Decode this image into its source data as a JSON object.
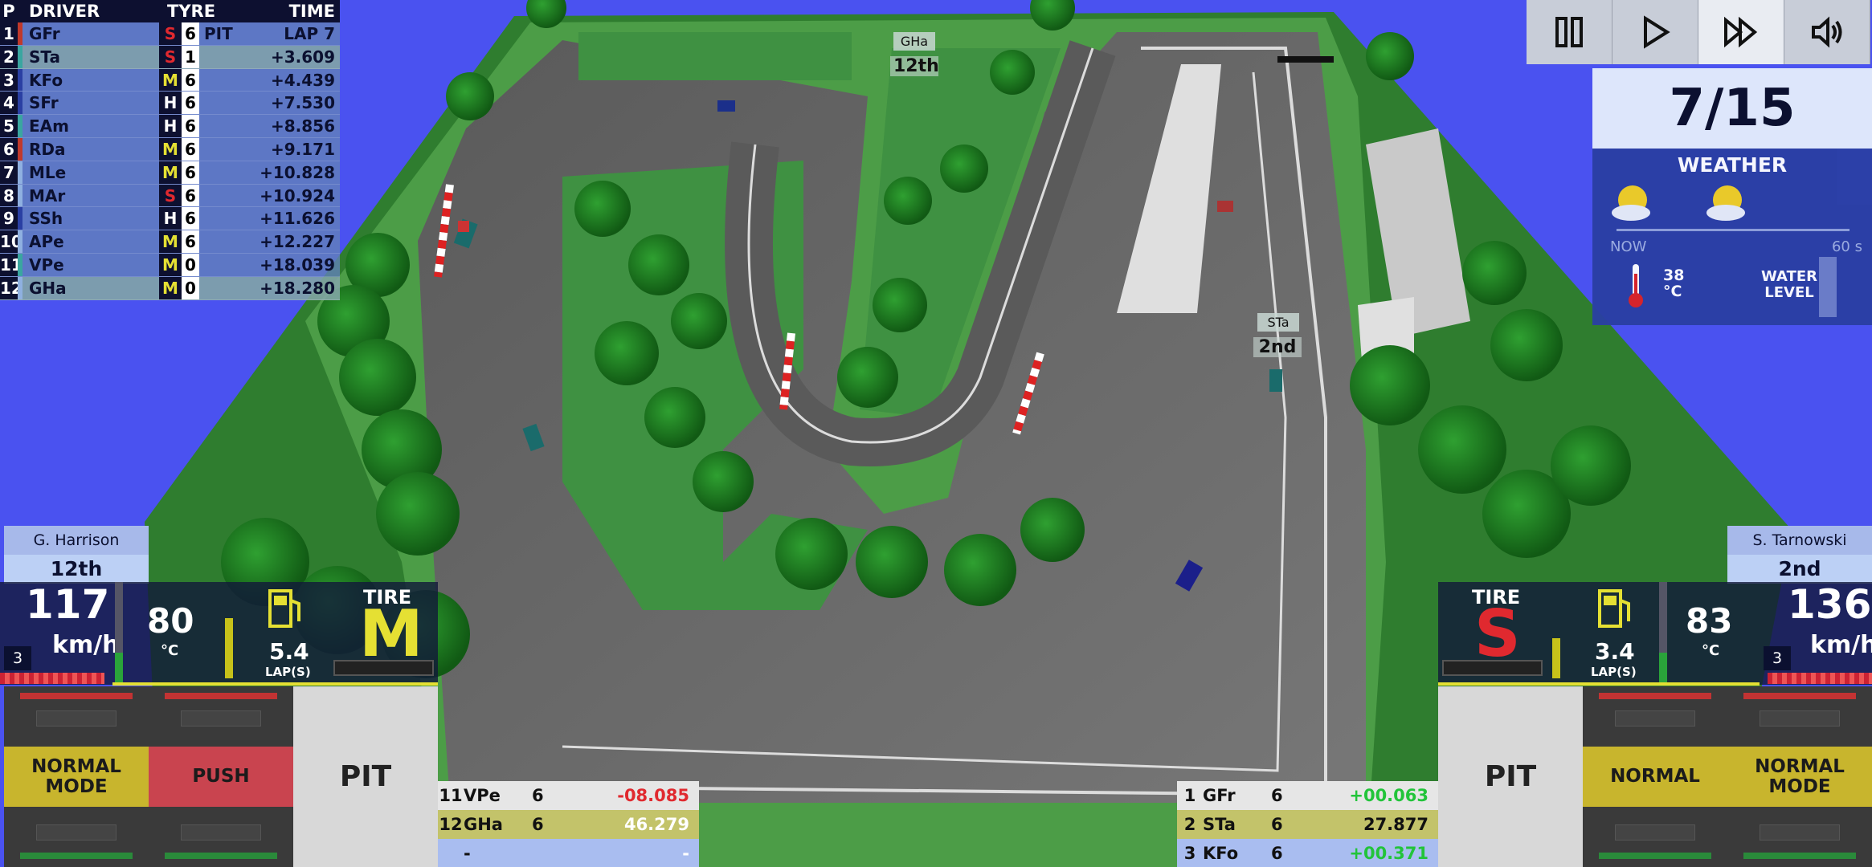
{
  "standings": {
    "headers": {
      "pos": "P",
      "driver": "DRIVER",
      "tyre": "TYRE",
      "time": "TIME"
    },
    "rows": [
      {
        "pos": "1",
        "driver": "GFr",
        "tyre": "S",
        "stint": "6",
        "pit": "PIT",
        "time": "LAP 7",
        "color": "#c0392b",
        "highlight": false
      },
      {
        "pos": "2",
        "driver": "STa",
        "tyre": "S",
        "stint": "1",
        "pit": "",
        "time": "+3.609",
        "color": "#3aa6a0",
        "highlight": true
      },
      {
        "pos": "3",
        "driver": "KFo",
        "tyre": "M",
        "stint": "6",
        "pit": "",
        "time": "+4.439",
        "color": "#2a3fa3",
        "highlight": false
      },
      {
        "pos": "4",
        "driver": "SFr",
        "tyre": "H",
        "stint": "6",
        "pit": "",
        "time": "+7.530",
        "color": "#2a3fa3",
        "highlight": false
      },
      {
        "pos": "5",
        "driver": "EAm",
        "tyre": "H",
        "stint": "6",
        "pit": "",
        "time": "+8.856",
        "color": "#3aa6a0",
        "highlight": false
      },
      {
        "pos": "6",
        "driver": "RDa",
        "tyre": "M",
        "stint": "6",
        "pit": "",
        "time": "+9.171",
        "color": "#c0392b",
        "highlight": false
      },
      {
        "pos": "7",
        "driver": "MLe",
        "tyre": "M",
        "stint": "6",
        "pit": "",
        "time": "+10.828",
        "color": "#8fb0e0",
        "highlight": false
      },
      {
        "pos": "8",
        "driver": "MAr",
        "tyre": "S",
        "stint": "6",
        "pit": "",
        "time": "+10.924",
        "color": "#8fb0e0",
        "highlight": false
      },
      {
        "pos": "9",
        "driver": "SSh",
        "tyre": "H",
        "stint": "6",
        "pit": "",
        "time": "+11.626",
        "color": "#2a3fa3",
        "highlight": false
      },
      {
        "pos": "10",
        "driver": "APe",
        "tyre": "M",
        "stint": "6",
        "pit": "",
        "time": "+12.227",
        "color": "#8fb0e0",
        "highlight": false
      },
      {
        "pos": "11",
        "driver": "VPe",
        "tyre": "M",
        "stint": "0",
        "pit": "",
        "time": "+18.039",
        "color": "#3aa6a0",
        "highlight": false
      },
      {
        "pos": "12",
        "driver": "GHa",
        "tyre": "M",
        "stint": "0",
        "pit": "",
        "time": "+18.280",
        "color": "#8fb0e0",
        "highlight": true
      }
    ]
  },
  "tyre_colors": {
    "S": "#e0292f",
    "M": "#e5e033",
    "H": "#ffffff"
  },
  "track_tags": [
    {
      "name": "GHa",
      "position": "12th"
    },
    {
      "name": "STa",
      "position": "2nd"
    }
  ],
  "race": {
    "lap_display": "7/15"
  },
  "weather": {
    "title": "WEATHER",
    "icons": [
      "sun-cloud",
      "sun-cloud"
    ],
    "now_label": "NOW",
    "end_label": "60 s",
    "temp_value": "38",
    "temp_unit": "°C",
    "water_label_1": "WATER",
    "water_label_2": "LEVEL"
  },
  "left_driver": {
    "name": "G. Harrison",
    "position": "12th",
    "speed": "117",
    "speed_unit": "km/h",
    "gear": "3",
    "temp": "80",
    "temp_unit": "°C",
    "fuel": "5.4",
    "fuel_unit": "LAP(S)",
    "tire_label": "TIRE",
    "tire_compound": "M"
  },
  "left_controls": {
    "mode_button": "NORMAL MODE",
    "push_button": "PUSH",
    "pit_button": "PIT"
  },
  "right_driver": {
    "name": "S. Tarnowski",
    "position": "2nd",
    "speed": "136",
    "speed_unit": "km/h",
    "gear": "3",
    "temp": "83",
    "temp_unit": "°C",
    "fuel": "3.4",
    "fuel_unit": "LAP(S)",
    "tire_label": "TIRE",
    "tire_compound": "S"
  },
  "right_controls": {
    "pit_button": "PIT",
    "push_button": "NORMAL",
    "mode_button": "NORMAL MODE"
  },
  "left_gaps": [
    {
      "pos": "11",
      "driver": "VPe",
      "stint": "6",
      "value": "-08.085",
      "value_color": "#e0292f",
      "bg": "#e6e6e6"
    },
    {
      "pos": "12",
      "driver": "GHa",
      "stint": "6",
      "value": "46.279",
      "value_color": "#ffffff",
      "bg": "#c3c36a"
    },
    {
      "pos": "",
      "driver": "-",
      "stint": "",
      "value": "-",
      "value_color": "#ffffff",
      "bg": "#a9bdf0"
    }
  ],
  "right_gaps": [
    {
      "pos": "1",
      "driver": "GFr",
      "stint": "6",
      "value": "+00.063",
      "value_color": "#22c43a",
      "bg": "#e6e6e6"
    },
    {
      "pos": "2",
      "driver": "STa",
      "stint": "6",
      "value": "27.877",
      "value_color": "#111111",
      "bg": "#c3c36a"
    },
    {
      "pos": "3",
      "driver": "KFo",
      "stint": "6",
      "value": "+00.371",
      "value_color": "#22c43a",
      "bg": "#a9bdf0"
    }
  ]
}
